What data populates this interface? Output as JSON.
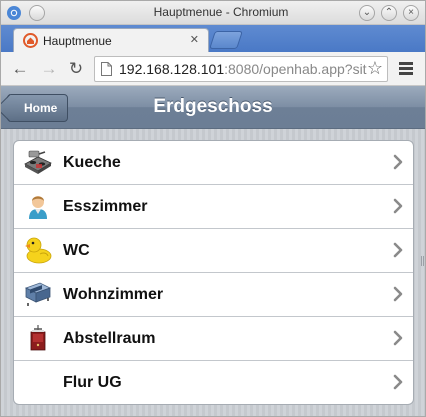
{
  "window": {
    "title": "Hauptmenue - Chromium"
  },
  "browser": {
    "tab_title": "Hauptmenue",
    "url_host": "192.168.128.101",
    "url_rest": ":8080/openhab.app?sit"
  },
  "app": {
    "home_label": "Home",
    "page_title": "Erdgeschoss",
    "items": [
      {
        "label": "Kueche",
        "icon": "kitchen-stove-icon"
      },
      {
        "label": "Esszimmer",
        "icon": "person-icon"
      },
      {
        "label": "WC",
        "icon": "rubber-duck-icon"
      },
      {
        "label": "Wohnzimmer",
        "icon": "sofa-icon"
      },
      {
        "label": "Abstellraum",
        "icon": "storage-cabinet-icon"
      },
      {
        "label": "Flur UG",
        "icon": ""
      }
    ]
  },
  "colors": {
    "header": "#7d8ea4",
    "tabstrip": "#5f8bd1"
  }
}
